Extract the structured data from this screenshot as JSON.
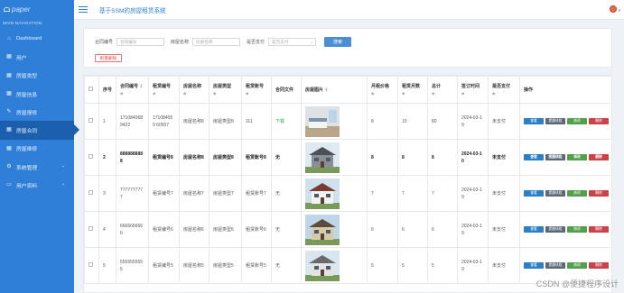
{
  "sidebar": {
    "logo": "paper",
    "section_label": "MAIN NAVIGATION",
    "items": [
      {
        "label": "Dashboard",
        "icon": "home-icon"
      },
      {
        "label": "用户",
        "icon": "grid-icon"
      },
      {
        "label": "房屋类型",
        "icon": "grid-icon"
      },
      {
        "label": "房屋信息",
        "icon": "grid-icon"
      },
      {
        "label": "房屋报修",
        "icon": "wrench-icon"
      },
      {
        "label": "房屋合同",
        "icon": "grid-icon"
      },
      {
        "label": "房屋维修",
        "icon": "grid-icon"
      },
      {
        "label": "系统管理",
        "icon": "gear-icon"
      },
      {
        "label": "用户资料",
        "icon": "user-icon"
      }
    ],
    "active_index": 5
  },
  "header": {
    "title": "基于SSM的房屋租赁系统"
  },
  "filters": {
    "contract_label": "合同编号",
    "contract_placeholder": "合同编号",
    "house_label": "房屋名称",
    "house_placeholder": "房屋名称",
    "paid_label": "是否支付",
    "paid_placeholder": "是否支付",
    "search_button": "搜索",
    "batch_delete_button": "批量删除"
  },
  "table": {
    "headers": [
      "",
      "序号",
      "合同编号",
      "租赁编号",
      "房屋名称",
      "房屋类型",
      "租赁账号",
      "合同文件",
      "房屋图片",
      "月租价格",
      "租赁月数",
      "总计",
      "签订时间",
      "是否支付",
      "操作"
    ],
    "sort_marker": "◆",
    "rows": [
      {
        "idx": "1",
        "contract": "171084068 9422",
        "lease": "171084059 60557",
        "name": "房屋名称8",
        "type": "房屋类型8",
        "account": "111",
        "file": "下载",
        "price": "8",
        "months": "10",
        "total": "80",
        "date": "2024-03-1 9",
        "paid": "未支付",
        "bold": false,
        "file_link": true
      },
      {
        "idx": "2",
        "contract": "888888888 8",
        "lease": "租赁编号8",
        "name": "房屋名称8",
        "type": "房屋类型8",
        "account": "租赁账号8",
        "file": "无",
        "price": "8",
        "months": "8",
        "total": "8",
        "date": "2024-03-1 0",
        "paid": "未支付",
        "bold": true,
        "file_link": false
      },
      {
        "idx": "3",
        "contract": "777777777 7",
        "lease": "租赁编号7",
        "name": "房屋名称7",
        "type": "房屋类型7",
        "account": "租赁账号7",
        "file": "无",
        "price": "7",
        "months": "7",
        "total": "7",
        "date": "2024-03-1 9",
        "paid": "未支付",
        "bold": false,
        "file_link": false
      },
      {
        "idx": "4",
        "contract": "666666666 6",
        "lease": "租赁编号6",
        "name": "房屋名称6",
        "type": "房屋类型6",
        "account": "租赁账号6",
        "file": "无",
        "price": "6",
        "months": "6",
        "total": "6",
        "date": "2024-03-1 9",
        "paid": "未支付",
        "bold": false,
        "file_link": false
      },
      {
        "idx": "5",
        "contract": "555555555 5",
        "lease": "租赁编号5",
        "name": "房屋名称5",
        "type": "房屋类型5",
        "account": "租赁账号5",
        "file": "无",
        "price": "5",
        "months": "5",
        "total": "5",
        "date": "2024-03-1 9",
        "paid": "未支付",
        "bold": false,
        "file_link": false
      }
    ],
    "ops": [
      "查看",
      "提醒续租",
      "修改",
      "删除"
    ]
  },
  "watermark": "CSDN @便捷程序设计",
  "colors": {
    "sidebar_bg": "#2f7fd8",
    "sidebar_active": "#1b5fae",
    "accent": "#2f7fd8",
    "view_btn": "#2a7fc7",
    "remind_btn": "#5a6778",
    "edit_btn": "#53a04c",
    "delete_btn": "#c9444a"
  }
}
